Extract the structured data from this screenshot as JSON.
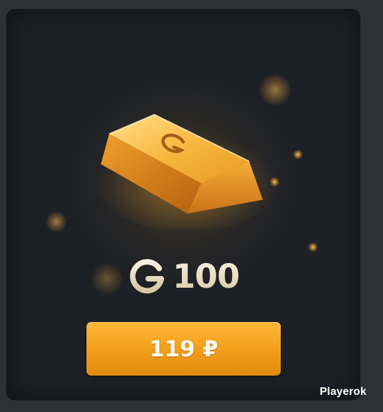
{
  "product": {
    "currency_icon": "g-coin-icon",
    "item_icon": "gold-bar-icon",
    "amount": "100",
    "price": "119 ₽"
  },
  "watermark": "Playerok",
  "colors": {
    "card_background": "#1d2026",
    "page_background": "#2d3136",
    "button_accent": "#f5a21e",
    "gold": "#f2a93a",
    "amount_text": "#e8dcc4"
  }
}
